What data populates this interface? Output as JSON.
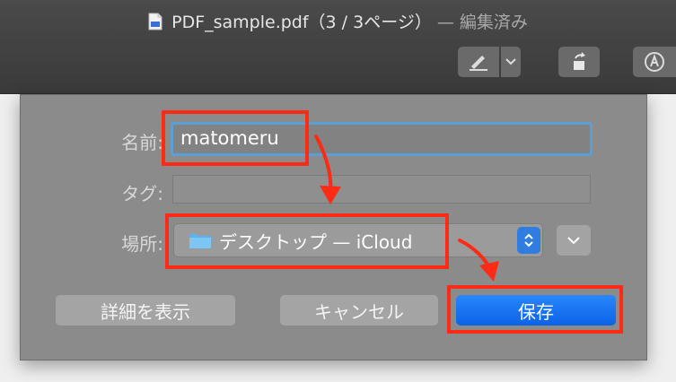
{
  "window": {
    "title": "PDF_sample.pdf（3 / 3ページ）",
    "edited": "— 編集済み"
  },
  "toolbar": {
    "icons": [
      "markup-pen-icon",
      "chevron-down-icon",
      "rotate-icon",
      "annotate-icon"
    ]
  },
  "dialog": {
    "name_label": "名前:",
    "name_value": "matomeru",
    "tag_label": "タグ:",
    "tag_value": "",
    "location_label": "場所:",
    "location_value": "デスクトップ — iCloud",
    "details_button": "詳細を表示",
    "cancel_button": "キャンセル",
    "save_button": "保存"
  },
  "colors": {
    "annotation": "#ff2b14",
    "save_button": "#0b63e6",
    "focus_ring": "#5a9fd8"
  }
}
